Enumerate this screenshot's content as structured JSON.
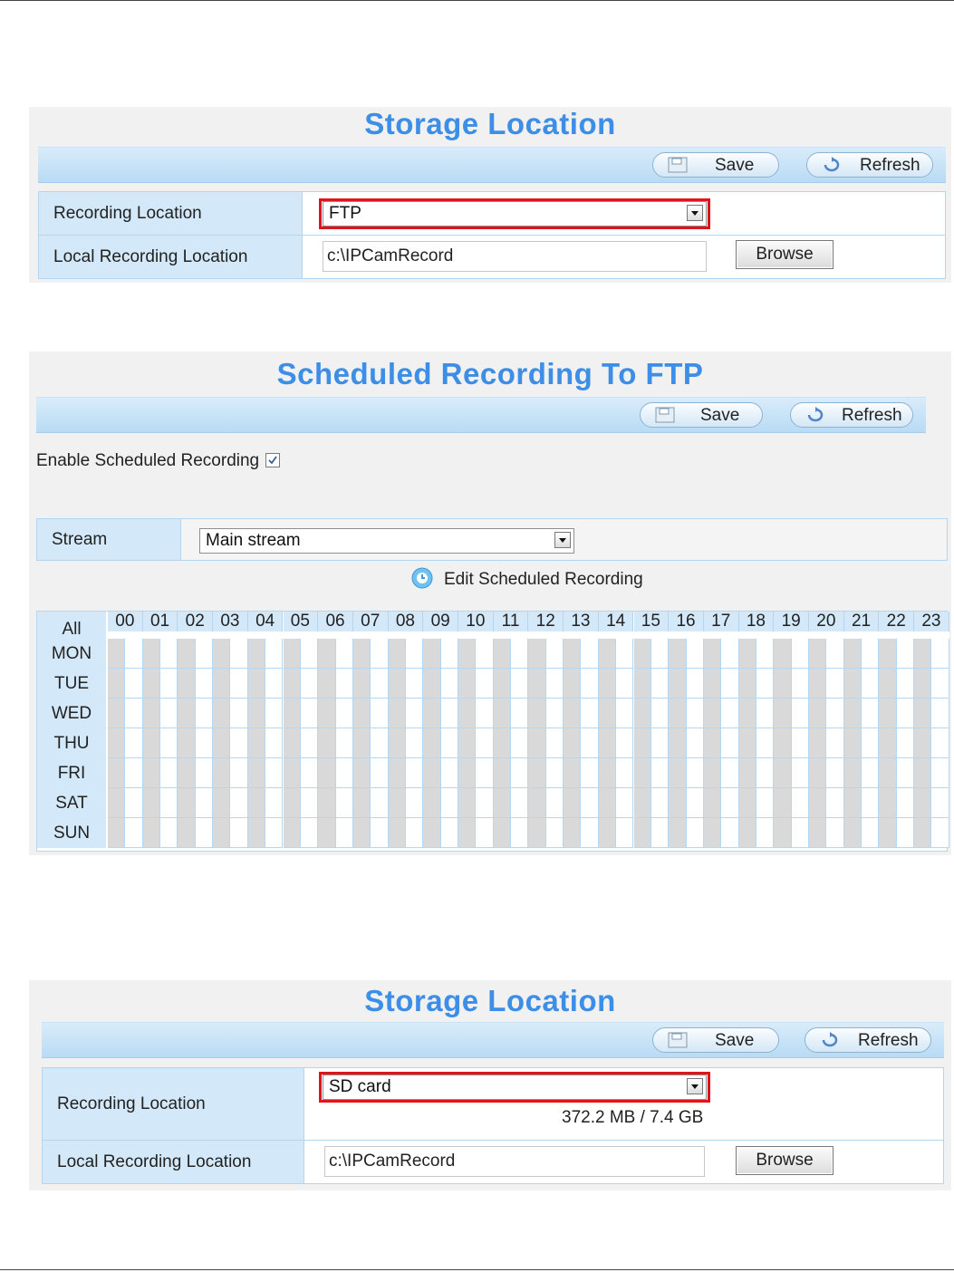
{
  "toolbar": {
    "save_label": "Save",
    "refresh_label": "Refresh"
  },
  "storage1": {
    "title": "Storage Location",
    "recording_location_label": "Recording Location",
    "recording_location_value": "FTP",
    "local_recording_label": "Local Recording Location",
    "local_recording_value": "c:\\IPCamRecord",
    "browse_label": "Browse"
  },
  "schedule": {
    "title": "Scheduled Recording To FTP",
    "enable_label": "Enable Scheduled Recording",
    "enable_checked": true,
    "stream_label": "Stream",
    "stream_value": "Main stream",
    "edit_label": "Edit Scheduled Recording",
    "all_label": "All",
    "hours": [
      "00",
      "01",
      "02",
      "03",
      "04",
      "05",
      "06",
      "07",
      "08",
      "09",
      "10",
      "11",
      "12",
      "13",
      "14",
      "15",
      "16",
      "17",
      "18",
      "19",
      "20",
      "21",
      "22",
      "23"
    ],
    "days": [
      "MON",
      "TUE",
      "WED",
      "THU",
      "FRI",
      "SAT",
      "SUN"
    ]
  },
  "storage2": {
    "title": "Storage Location",
    "recording_location_label": "Recording Location",
    "recording_location_value": "SD card",
    "capacity": "372.2 MB / 7.4 GB",
    "local_recording_label": "Local Recording Location",
    "local_recording_value": "c:\\IPCamRecord",
    "browse_label": "Browse"
  },
  "colors": {
    "title": "#3d8ee6",
    "highlight": "#e0141b",
    "label_bg": "#d3e8f8"
  }
}
